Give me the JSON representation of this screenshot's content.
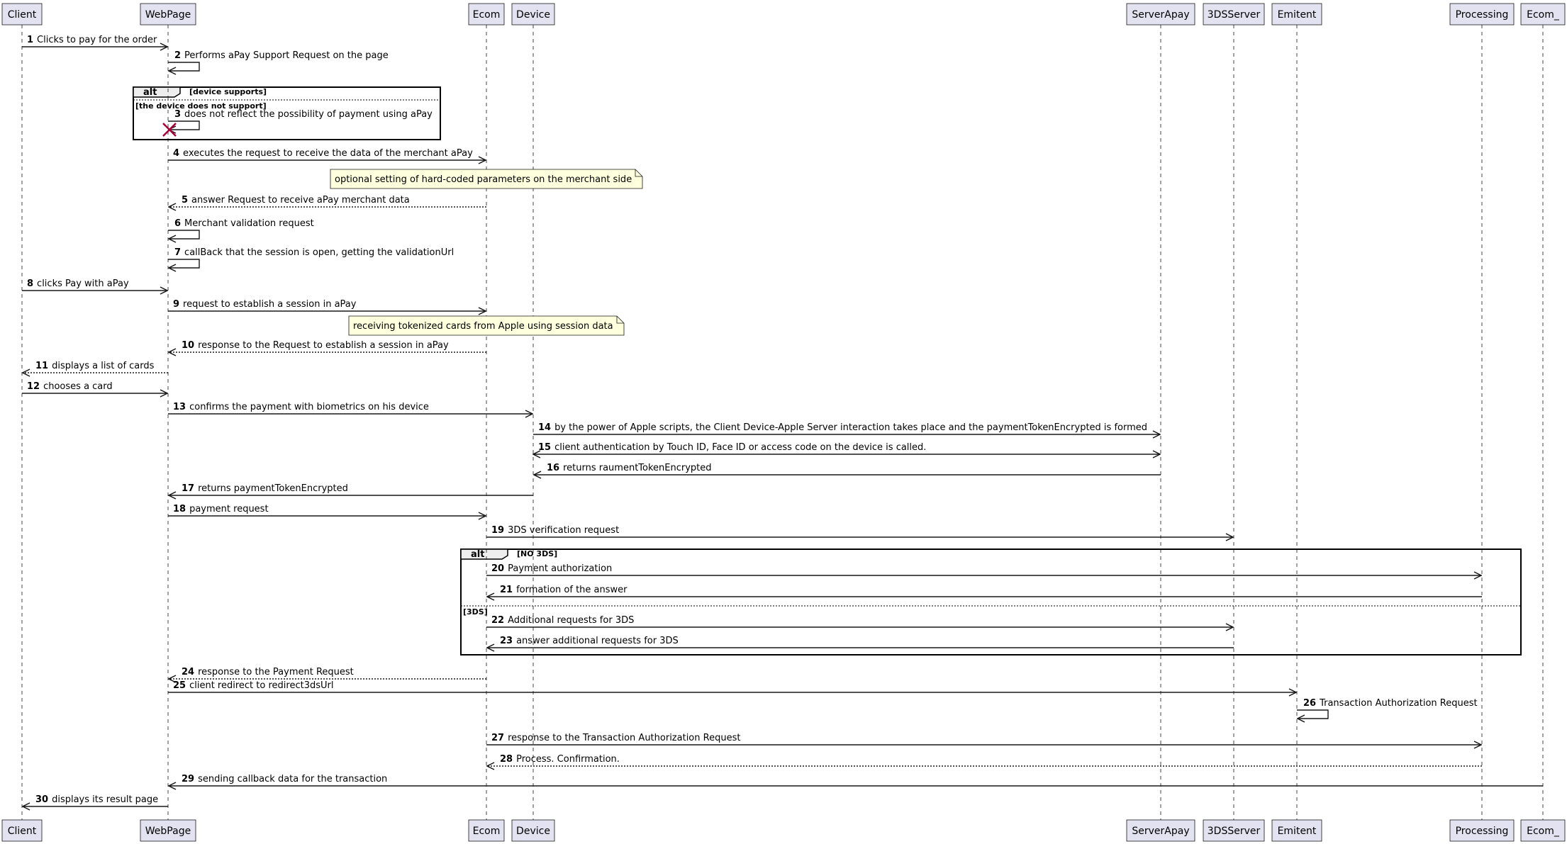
{
  "participants": [
    {
      "id": "Client",
      "label": "Client"
    },
    {
      "id": "WebPage",
      "label": "WebPage"
    },
    {
      "id": "Ecom",
      "label": "Ecom"
    },
    {
      "id": "Device",
      "label": "Device"
    },
    {
      "id": "ServerApay",
      "label": "ServerApay"
    },
    {
      "id": "3DSServer",
      "label": "3DSServer"
    },
    {
      "id": "Emitent",
      "label": "Emitent"
    },
    {
      "id": "Processing",
      "label": "Processing"
    },
    {
      "id": "Ecom_",
      "label": "Ecom_"
    }
  ],
  "messages": [
    {
      "num": "1",
      "from": "Client",
      "to": "WebPage",
      "text": "Clicks to pay for the order",
      "style": "solid"
    },
    {
      "num": "2",
      "from": "WebPage",
      "to": "WebPage",
      "text": "Performs aPay Support Request on the page",
      "style": "solid"
    },
    {
      "num": "3",
      "from": "WebPage",
      "to": "WebPage",
      "text": "does not reflect the possibility of payment using aPay",
      "style": "solid",
      "destroy": true
    },
    {
      "num": "4",
      "from": "WebPage",
      "to": "Ecom",
      "text": "executes the request to receive the data of the merchant aPay",
      "style": "solid"
    },
    {
      "num": "5",
      "from": "Ecom",
      "to": "WebPage",
      "text": "answer Request to receive aPay merchant data",
      "style": "dashed"
    },
    {
      "num": "6",
      "from": "WebPage",
      "to": "WebPage",
      "text": "Merchant validation request",
      "style": "solid"
    },
    {
      "num": "7",
      "from": "WebPage",
      "to": "WebPage",
      "text": "callBack that the session is open, getting the validationUrl",
      "style": "solid"
    },
    {
      "num": "8",
      "from": "Client",
      "to": "WebPage",
      "text": "clicks Pay with aPay",
      "style": "solid"
    },
    {
      "num": "9",
      "from": "WebPage",
      "to": "Ecom",
      "text": "request to establish a session in aPay",
      "style": "solid"
    },
    {
      "num": "10",
      "from": "Ecom",
      "to": "WebPage",
      "text": "response to the Request to establish a session in aPay",
      "style": "dashed"
    },
    {
      "num": "11",
      "from": "WebPage",
      "to": "Client",
      "text": "displays a list of cards",
      "style": "dashed"
    },
    {
      "num": "12",
      "from": "Client",
      "to": "WebPage",
      "text": "chooses a card",
      "style": "solid"
    },
    {
      "num": "13",
      "from": "WebPage",
      "to": "Device",
      "text": "confirms the payment with biometrics on his device",
      "style": "solid"
    },
    {
      "num": "14",
      "from": "Device",
      "to": "ServerApay",
      "text": "by the power of Apple scripts, the Client Device-Apple Server interaction takes place and the paymentTokenEncrypted is formed",
      "style": "solid"
    },
    {
      "num": "15",
      "from": "Device",
      "to": "ServerApay",
      "text": "client authentication by Touch ID, Face ID or access code on the device is called.",
      "style": "solid",
      "both": true
    },
    {
      "num": "16",
      "from": "ServerApay",
      "to": "Device",
      "text": "returns raumentTokenEncrypted",
      "style": "solid"
    },
    {
      "num": "17",
      "from": "Device",
      "to": "WebPage",
      "text": "returns paymentTokenEncrypted",
      "style": "solid"
    },
    {
      "num": "18",
      "from": "WebPage",
      "to": "Ecom",
      "text": "payment request",
      "style": "solid"
    },
    {
      "num": "19",
      "from": "Ecom",
      "to": "3DSServer",
      "text": "3DS verification request",
      "style": "solid"
    },
    {
      "num": "20",
      "from": "Ecom",
      "to": "Processing",
      "text": "Payment authorization",
      "style": "solid"
    },
    {
      "num": "21",
      "from": "Processing",
      "to": "Ecom",
      "text": "formation of the answer",
      "style": "solid"
    },
    {
      "num": "22",
      "from": "Ecom",
      "to": "3DSServer",
      "text": "Additional requests for 3DS",
      "style": "solid"
    },
    {
      "num": "23",
      "from": "3DSServer",
      "to": "Ecom",
      "text": "answer additional requests for 3DS",
      "style": "solid"
    },
    {
      "num": "24",
      "from": "Ecom",
      "to": "WebPage",
      "text": "response to the Payment Request",
      "style": "dashed"
    },
    {
      "num": "25",
      "from": "WebPage",
      "to": "Emitent",
      "text": "client redirect to redirect3dsUrl",
      "style": "solid"
    },
    {
      "num": "26",
      "from": "Emitent",
      "to": "Emitent",
      "text": "Transaction Authorization Request",
      "style": "solid"
    },
    {
      "num": "27",
      "from": "Ecom",
      "to": "Processing",
      "text": "response to the Transaction Authorization Request",
      "style": "solid"
    },
    {
      "num": "28",
      "from": "Processing",
      "to": "Ecom",
      "text": "Process. Confirmation.",
      "style": "dashed"
    },
    {
      "num": "29",
      "from": "Ecom_",
      "to": "WebPage",
      "text": "sending callback data for the transaction",
      "style": "solid"
    },
    {
      "num": "30",
      "from": "WebPage",
      "to": "Client",
      "text": "displays its result page",
      "style": "solid"
    }
  ],
  "notes": [
    {
      "text": "optional setting of hard-coded parameters on the merchant side",
      "over": "Ecom"
    },
    {
      "text": "receiving tokenized cards from Apple using session data",
      "over": "Ecom"
    }
  ],
  "frames": [
    {
      "operator": "alt",
      "guards": [
        "[device supports]",
        "[the device does not support]"
      ]
    },
    {
      "operator": "alt",
      "guards": [
        "[NO 3DS]",
        "[3DS]"
      ]
    }
  ]
}
